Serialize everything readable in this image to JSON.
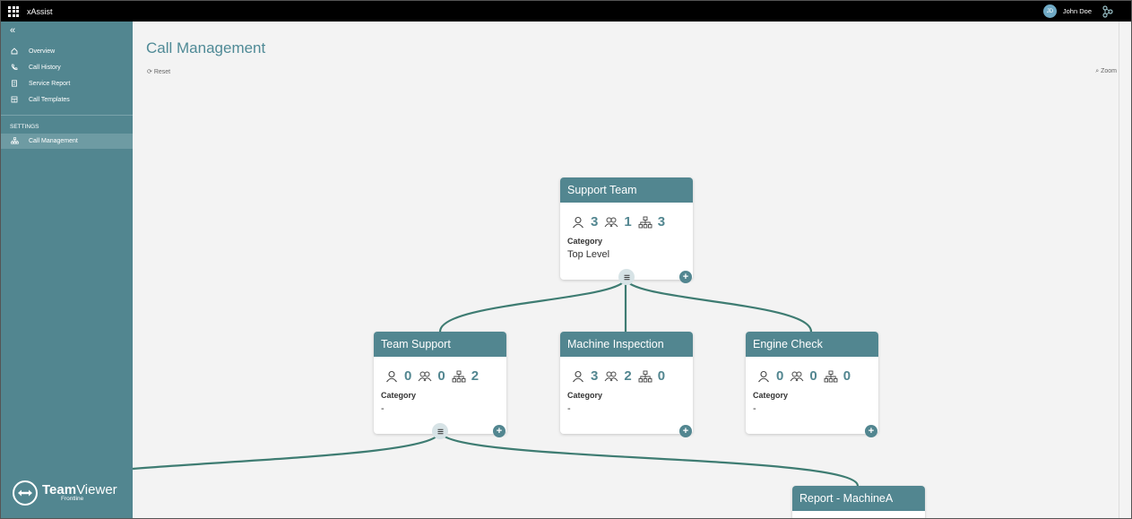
{
  "app": {
    "title": "xAssist"
  },
  "user": {
    "initials": "JD",
    "name": "John Doe"
  },
  "sidebar": {
    "collapse_icon": "double-chevron-left-icon",
    "items": [
      {
        "label": "Overview",
        "icon": "home-icon"
      },
      {
        "label": "Call History",
        "icon": "phone-history-icon"
      },
      {
        "label": "Service Report",
        "icon": "report-icon"
      },
      {
        "label": "Call Templates",
        "icon": "template-icon"
      }
    ],
    "settings_label": "SETTINGS",
    "settings_items": [
      {
        "label": "Call Management",
        "icon": "hierarchy-icon",
        "active": true
      }
    ],
    "logo": {
      "main_bold": "Team",
      "main_light": "Viewer",
      "sub": "Frontline"
    }
  },
  "main": {
    "title": "Call Management",
    "reset_label": "Reset",
    "zoom_label": "Zoom"
  },
  "cards": [
    {
      "title": "Support Team",
      "users": "3",
      "groups": "1",
      "subnodes": "3",
      "category_label": "Category",
      "category": "Top Level"
    },
    {
      "title": "Team Support",
      "users": "0",
      "groups": "0",
      "subnodes": "2",
      "category_label": "Category",
      "category": "-"
    },
    {
      "title": "Machine Inspection",
      "users": "3",
      "groups": "2",
      "subnodes": "0",
      "category_label": "Category",
      "category": "-"
    },
    {
      "title": "Engine Check",
      "users": "0",
      "groups": "0",
      "subnodes": "0",
      "category_label": "Category",
      "category": "-"
    },
    {
      "title": "Report - MachineA"
    }
  ],
  "colors": {
    "accent": "#528690",
    "topbar": "#000000",
    "background": "#f3f3f3"
  }
}
